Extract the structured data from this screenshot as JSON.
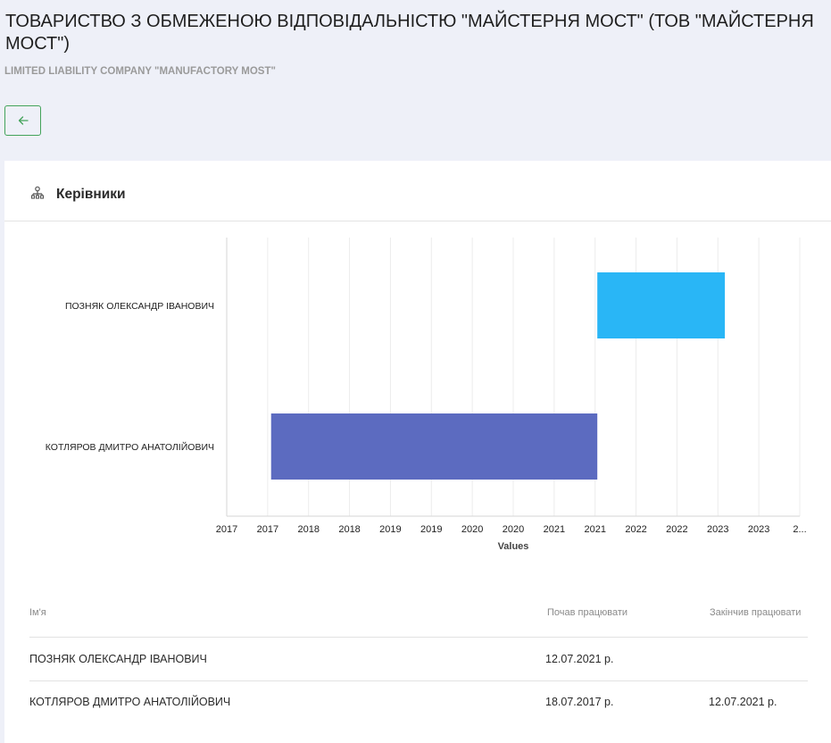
{
  "page": {
    "title": "ТОВАРИСТВО З ОБМЕЖЕНОЮ ВІДПОВІДАЛЬНІСТЮ \"МАЙСТЕРНЯ МОСТ\" (ТОВ \"МАЙСТЕРНЯ МОСТ\")",
    "subtitle": "LIMITED LIABILITY COMPANY \"MANUFACTORY MOST\""
  },
  "nav": {
    "back_icon": "arrow-left-icon"
  },
  "section": {
    "title": "Керівники",
    "icon": "org-structure-icon"
  },
  "chart_data": {
    "type": "bar",
    "orientation": "horizontal-range",
    "categories": [
      "ПОЗНЯК ОЛЕКСАНДР ІВАНОВИЧ",
      "КОТЛЯРОВ ДМИТРО АНАТОЛІЙОВИЧ"
    ],
    "series": [
      {
        "start": "2021-07-12",
        "end": "2023-02-01",
        "color": "#29b6f6"
      },
      {
        "start": "2017-07-18",
        "end": "2021-07-12",
        "color": "#5c6bc0"
      }
    ],
    "x_tick_labels": [
      "2017",
      "2017",
      "2018",
      "2018",
      "2019",
      "2019",
      "2020",
      "2020",
      "2021",
      "2021",
      "2022",
      "2022",
      "2023",
      "2023",
      "2..."
    ],
    "xlabel": "Values",
    "ylabel": "",
    "xlim": [
      "2017-01-01",
      "2024-01-01"
    ],
    "grid": true
  },
  "table": {
    "headers": {
      "name": "Ім'я",
      "start": "Почав працювати",
      "end": "Закінчив працювати"
    },
    "rows": [
      {
        "name": "ПОЗНЯК ОЛЕКСАНДР ІВАНОВИЧ",
        "start": "12.07.2021 р.",
        "end": ""
      },
      {
        "name": "КОТЛЯРОВ ДМИТРО АНАТОЛІЙОВИЧ",
        "start": "18.07.2017 р.",
        "end": "12.07.2021 р."
      }
    ]
  }
}
